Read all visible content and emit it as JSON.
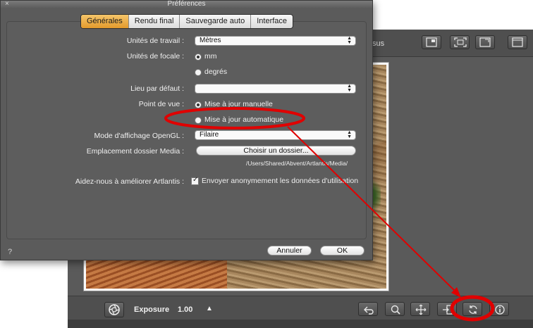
{
  "app": {
    "top_label": "sus",
    "exposure_label": "Exposure",
    "exposure_value": "1.00",
    "exposure_up_glyph": "▲"
  },
  "dialog": {
    "title": "Préférences",
    "close_glyph": "×",
    "tabs": [
      {
        "label": "Générales",
        "active": true
      },
      {
        "label": "Rendu final",
        "active": false
      },
      {
        "label": "Sauvegarde auto",
        "active": false
      },
      {
        "label": "Interface",
        "active": false
      }
    ],
    "work_units_label": "Unités de travail :",
    "work_units_value": "Mètres",
    "focal_units_label": "Unités de focale :",
    "focal_option_mm": "mm",
    "focal_option_degrees": "degrés",
    "default_location_label": "Lieu par défaut :",
    "default_location_value": "",
    "viewpoint_label": "Point de vue :",
    "viewpoint_option_manual": "Mise à jour manuelle",
    "viewpoint_option_auto": "Mise à jour automatique",
    "opengl_label": "Mode d'affichage OpenGL :",
    "opengl_value": "Filaire",
    "media_folder_label": "Emplacement dossier Media :",
    "media_folder_button": "Choisir un dossier...",
    "media_folder_path": "/Users/Shared/Abvent/Artlantis/Media/",
    "improve_label": "Aidez-nous à améliorer Artlantis :",
    "improve_checkbox_label": "Envoyer anonymement les données d'utilisation",
    "cancel_button": "Annuler",
    "ok_button": "OK",
    "help_glyph": "?"
  },
  "icons": {
    "top_toolbar": [
      "frame-corner-icon",
      "fit-view-icon",
      "frame-resize-icon",
      "window-icon"
    ],
    "bottom_toolbar": [
      "undo-arrow-icon",
      "zoom-icon",
      "pan-move-icon",
      "import-icon",
      "refresh-icon",
      "info-icon"
    ],
    "aperture": "aperture-icon"
  },
  "colors": {
    "active_tab": "#e8a33a",
    "annotation_red": "#e00000",
    "dialog_bg": "#5b5b5b",
    "app_bg": "#5a5a5a"
  }
}
